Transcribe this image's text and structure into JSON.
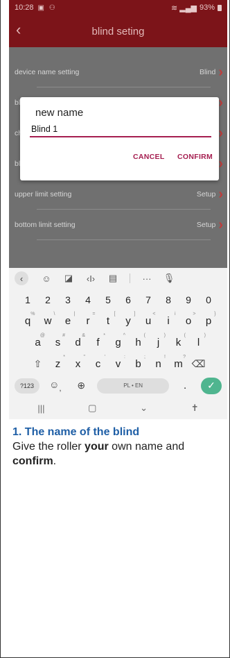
{
  "status": {
    "time": "10:28",
    "right_text": "93%"
  },
  "appbar": {
    "back_icon": "chevron-left-icon",
    "title": "blind seting"
  },
  "rows": [
    {
      "label": "device name setting",
      "value": "Blind"
    },
    {
      "label": "bli",
      "value": ""
    },
    {
      "label": "ch",
      "value": ""
    },
    {
      "label": "bli",
      "value": ""
    },
    {
      "label": "upper limit setting",
      "value": "Setup"
    },
    {
      "label": "bottom limit setting",
      "value": "Setup"
    }
  ],
  "dialog": {
    "title": "new name",
    "input_value": "Blind 1",
    "cancel_label": "CANCEL",
    "confirm_label": "CONFIRM",
    "accent_color": "#a51e50"
  },
  "keyboard": {
    "numbers": [
      "1",
      "2",
      "3",
      "4",
      "5",
      "6",
      "7",
      "8",
      "9",
      "0"
    ],
    "row1": [
      "q",
      "w",
      "e",
      "r",
      "t",
      "y",
      "u",
      "i",
      "o",
      "p"
    ],
    "row1_sup": [
      "%",
      "\\",
      "|",
      "=",
      "[",
      "]",
      "<",
      "i",
      ">",
      "}"
    ],
    "row2": [
      "a",
      "s",
      "d",
      "f",
      "g",
      "h",
      "j",
      "k",
      "l"
    ],
    "row2_sup": [
      "@",
      "#",
      "&",
      "*",
      "^",
      "(",
      ")",
      "(",
      ")"
    ],
    "row3": [
      "z",
      "x",
      "c",
      "v",
      "b",
      "n",
      "m"
    ],
    "row3_sup": [
      "*",
      "\"",
      "'",
      ":",
      ";",
      "!",
      "?"
    ],
    "mode_label": "?123",
    "space_label": "PL • EN",
    "period_label": ".",
    "comma_label": ","
  },
  "caption": {
    "heading": "1. The name of the blind",
    "line_part1": "Give the roller ",
    "line_bold1": "your",
    "line_part2": " own name and ",
    "line_bold2": "confirm",
    "line_end": "."
  },
  "colors": {
    "appbar": "#7c1419",
    "list_bg": "#707070",
    "chevron": "#c23a3a",
    "caption_heading": "#1f5fa6"
  }
}
